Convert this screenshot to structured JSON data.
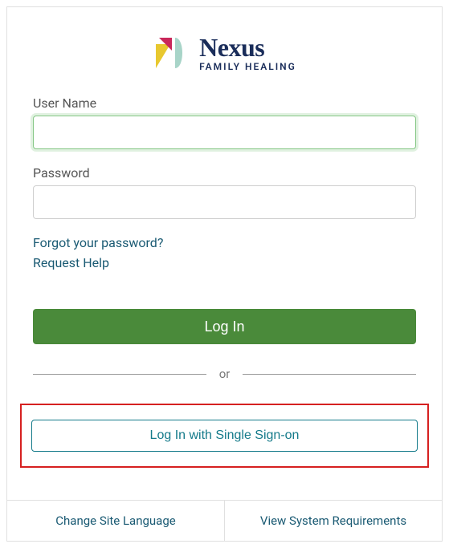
{
  "brand": {
    "name": "Nexus",
    "tagline": "FAMILY HEALING"
  },
  "form": {
    "username_label": "User Name",
    "username_value": "",
    "password_label": "Password",
    "password_value": ""
  },
  "links": {
    "forgot_password": "Forgot your password?",
    "request_help": "Request Help"
  },
  "buttons": {
    "login": "Log In",
    "sso": "Log In with Single Sign-on"
  },
  "divider": {
    "text": "or"
  },
  "footer": {
    "change_language": "Change Site Language",
    "system_requirements": "View System Requirements"
  }
}
